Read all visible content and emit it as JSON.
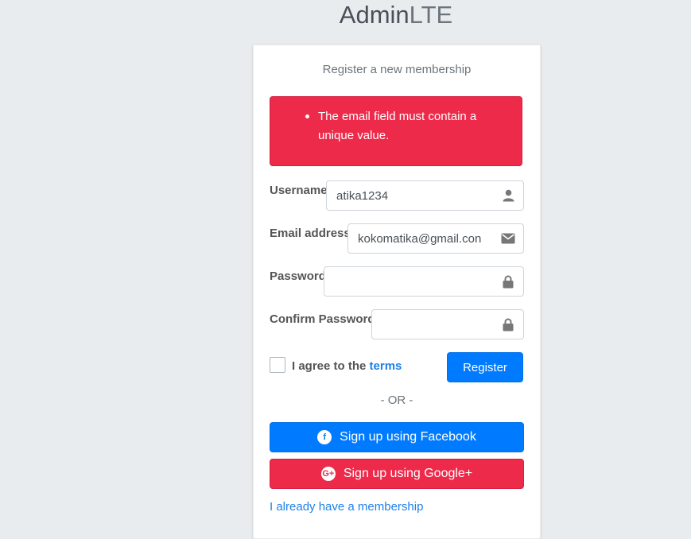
{
  "logo": {
    "bold": "Admin",
    "light": "LTE"
  },
  "register": {
    "box_msg": "Register a new membership",
    "alert": {
      "message": "The email field must contain a unique value."
    },
    "fields": {
      "username": {
        "label": "Username",
        "value": "atika1234",
        "icon": "user-icon"
      },
      "email": {
        "label": "Email address",
        "value": "kokomatika@gmail.con",
        "icon": "envelope-icon"
      },
      "password": {
        "label": "Password",
        "value": "",
        "icon": "lock-icon"
      },
      "confirm_password": {
        "label": "Confirm Password",
        "value": "",
        "icon": "lock-icon"
      }
    },
    "terms": {
      "prefix": "I agree to the ",
      "link": "terms",
      "checked": false
    },
    "buttons": {
      "register": "Register"
    },
    "or_text": "- OR -",
    "social": {
      "facebook": "Sign up using Facebook",
      "google": "Sign up using Google+"
    },
    "already": "I already have a membership"
  },
  "colors": {
    "page_bg": "#e9ecef",
    "primary": "#007bff",
    "danger": "#ee2a4b",
    "link": "#1e80e8"
  }
}
